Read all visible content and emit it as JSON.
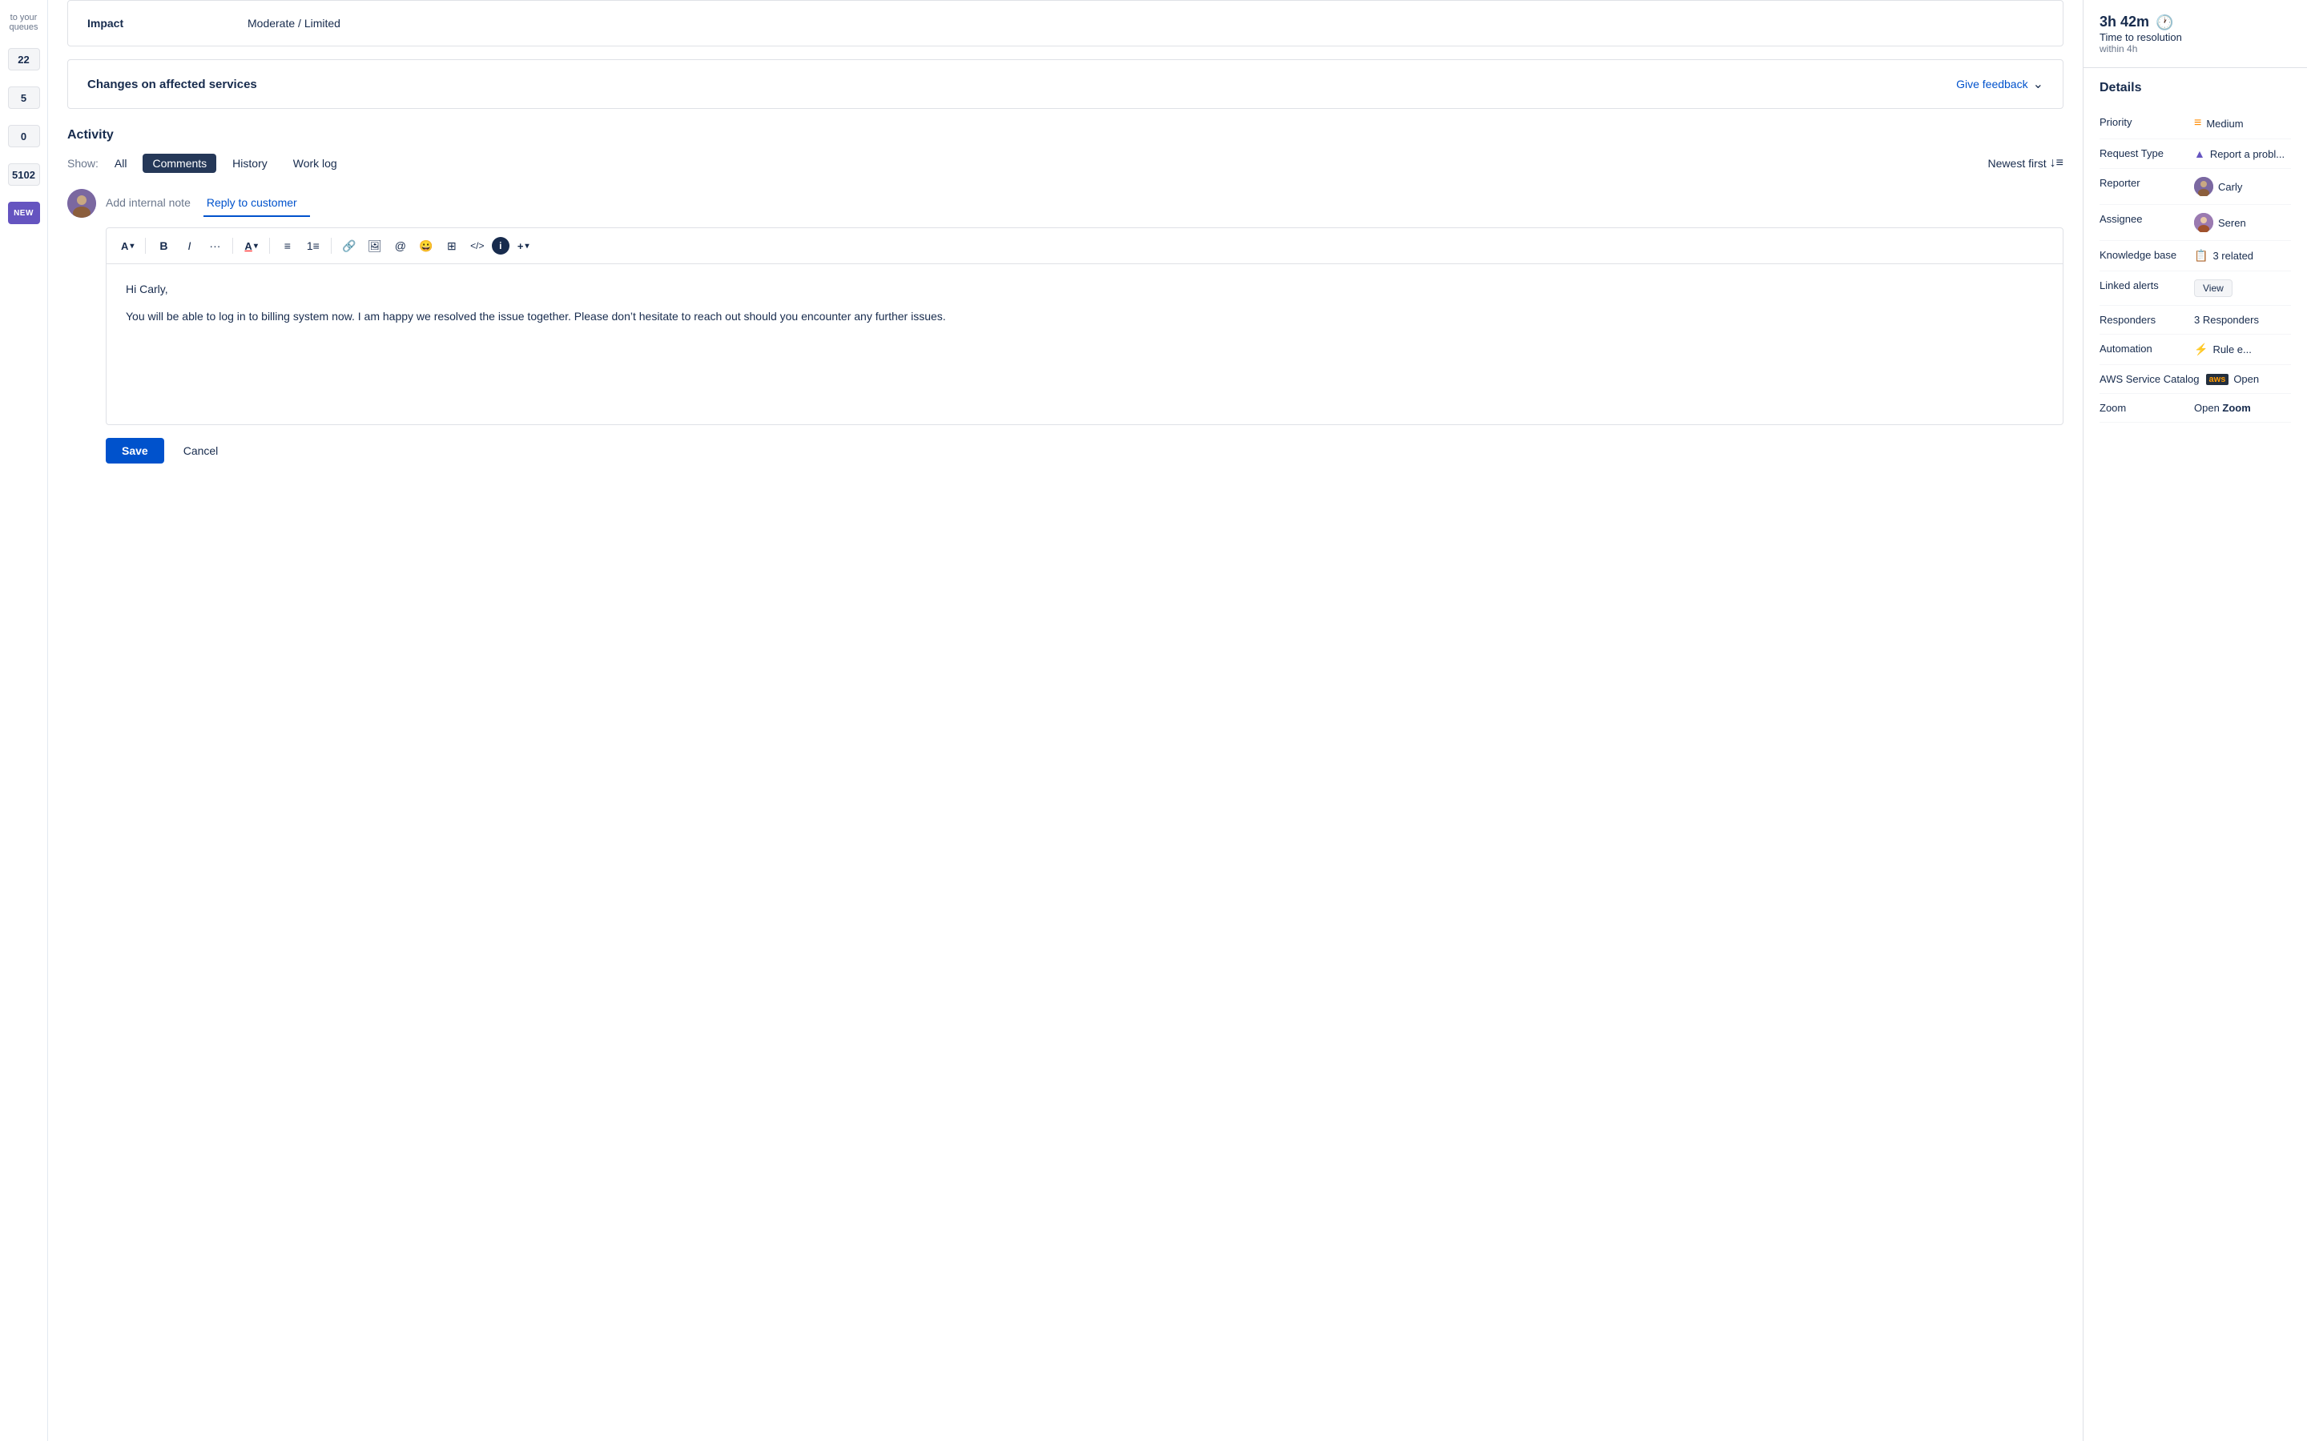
{
  "sidebar": {
    "items": [
      {
        "label": "to your queues",
        "badge": null,
        "badgeText": null
      },
      {
        "label": "22",
        "badge": "22",
        "badgeText": "22"
      },
      {
        "label": "5",
        "badge": "5",
        "badgeText": "5"
      },
      {
        "label": "0",
        "badge": "0",
        "badgeText": "0"
      },
      {
        "label": "5102",
        "badge": "5102",
        "badgeText": "5102"
      },
      {
        "label": "NEW",
        "badge": "NEW",
        "badgeText": "NEW",
        "isNew": true
      }
    ],
    "queue_text": "to your queues"
  },
  "impact": {
    "label": "Impact",
    "value": "Moderate / Limited"
  },
  "changes": {
    "title": "Changes on affected services",
    "feedback_btn": "Give feedback"
  },
  "activity": {
    "title": "Activity",
    "show_label": "Show:",
    "filters": [
      "All",
      "Comments",
      "History",
      "Work log"
    ],
    "active_filter": "Comments",
    "sort_label": "Newest first"
  },
  "reply": {
    "internal_note_tab": "Add internal note",
    "reply_tab": "Reply to customer",
    "active_tab": "reply",
    "message_line1": "Hi Carly,",
    "message_line2": "You will be able to log in to billing system now. I am happy we resolved the issue together. Please don’t hesitate to reach out should you encounter any further issues."
  },
  "actions": {
    "save": "Save",
    "cancel": "Cancel"
  },
  "toolbar": {
    "buttons": [
      {
        "icon": "A↓",
        "name": "font-size",
        "type": "dropdown"
      },
      {
        "icon": "B",
        "name": "bold",
        "type": "button"
      },
      {
        "icon": "I",
        "name": "italic",
        "type": "button"
      },
      {
        "icon": "…",
        "name": "more-text",
        "type": "button"
      },
      {
        "icon": "A↓",
        "name": "text-color",
        "type": "dropdown"
      },
      {
        "icon": "•≡",
        "name": "bullet-list",
        "type": "button"
      },
      {
        "icon": "1≡",
        "name": "numbered-list",
        "type": "button"
      },
      {
        "icon": "🔗",
        "name": "link",
        "type": "button"
      },
      {
        "icon": "🖼",
        "name": "image",
        "type": "button"
      },
      {
        "icon": "@",
        "name": "mention",
        "type": "button"
      },
      {
        "icon": "😀",
        "name": "emoji",
        "type": "button"
      },
      {
        "icon": "⋯",
        "name": "table",
        "type": "button"
      },
      {
        "icon": "</>",
        "name": "code",
        "type": "button"
      },
      {
        "icon": "ℹ",
        "name": "info",
        "type": "button"
      },
      {
        "icon": "+↓",
        "name": "more",
        "type": "dropdown"
      }
    ]
  },
  "right_panel": {
    "ttr": {
      "time": "3h 42m",
      "label": "Time to resolution",
      "sub": "within 4h"
    },
    "details_title": "Details",
    "details": [
      {
        "label": "Priority",
        "value": "Medium",
        "icon": "priority-bars",
        "iconColor": "#ff8b00"
      },
      {
        "label": "Request Type",
        "value": "Report a problem",
        "icon": "triangle",
        "iconColor": "#6554c0"
      },
      {
        "label": "Reporter",
        "value": "Carly",
        "icon": "avatar",
        "avatarInitial": "C"
      },
      {
        "label": "Assignee",
        "value": "Seren",
        "icon": "avatar",
        "avatarInitial": "S"
      },
      {
        "label": "Knowledge base",
        "value": "3 related",
        "icon": "book"
      },
      {
        "label": "Linked alerts",
        "value": "View",
        "icon": null,
        "isButton": true
      },
      {
        "label": "Responders",
        "value": "3 Responders",
        "icon": null
      },
      {
        "label": "Automation",
        "value": "Rule e...",
        "icon": "bolt",
        "iconColor": "#6554c0"
      },
      {
        "label": "AWS Service Catalog",
        "value": "Open",
        "icon": "aws"
      },
      {
        "label": "Zoom",
        "value": "Open Zoom",
        "icon": null
      }
    ]
  }
}
